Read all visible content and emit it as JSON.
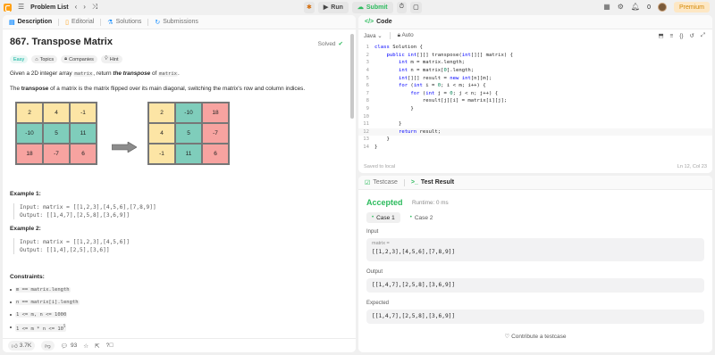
{
  "topnav": {
    "problem_list": "Problem List",
    "run": "Run",
    "submit": "Submit",
    "notifications": "0",
    "premium": "Premium"
  },
  "left": {
    "tabs": [
      "Description",
      "Editorial",
      "Solutions",
      "Submissions"
    ],
    "title": "867. Transpose Matrix",
    "solved": "Solved",
    "chips": [
      "Easy",
      "Topics",
      "Companies",
      "Hint"
    ],
    "p1_a": "Given a 2D integer array ",
    "p1_code1": "matrix",
    "p1_b": ", return ",
    "p1_em": "the transpose",
    "p1_c": " of ",
    "p1_code2": "matrix",
    "p1_d": ".",
    "p2_a": "The ",
    "p2_b": "transpose",
    "p2_c": " of a matrix is the matrix flipped over its main diagonal, switching the matrix's row and column indices.",
    "matrix_a": [
      [
        "2",
        "4",
        "-1"
      ],
      [
        "-10",
        "5",
        "11"
      ],
      [
        "18",
        "-7",
        "6"
      ]
    ],
    "matrix_b": [
      [
        "2",
        "-10",
        "18"
      ],
      [
        "4",
        "5",
        "-7"
      ],
      [
        "-1",
        "11",
        "6"
      ]
    ],
    "colors": {
      "yellow": "#fce5a5",
      "teal": "#7fcdbb",
      "red": "#f7a3a0"
    },
    "example1_title": "Example 1:",
    "example1_body": "Input: matrix = [[1,2,3],[4,5,6],[7,8,9]]\nOutput: [[1,4,7],[2,5,8],[3,6,9]]",
    "example2_title": "Example 2:",
    "example2_body": "Input: matrix = [[1,2,3],[4,5,6]]\nOutput: [[1,4],[2,5],[3,6]]",
    "constraints_title": "Constraints:",
    "constraints": [
      "m == matrix.length",
      "n == matrix[i].length",
      "1 <= m, n <= 1000",
      "1 <= m * n <= 10"
    ],
    "constraint_sup": "5",
    "likes": "3.7K",
    "comments": "93"
  },
  "code": {
    "tab": "Code",
    "language": "Java",
    "auto": "Auto",
    "lines": [
      "class Solution {",
      "    public int[][] transpose(int[][] matrix) {",
      "        int m = matrix.length;",
      "        int n = matrix[0].length;",
      "        int[][] result = new int[n][m];",
      "        for (int i = 0; i < m; i++) {",
      "            for (int j = 0; j < n; j++) {",
      "                result[j][i] = matrix[i][j];",
      "            }",
      "",
      "        }",
      "        return result;",
      "    }",
      "}"
    ],
    "saved": "Saved to local",
    "cursor": "Ln 12, Col 23"
  },
  "result": {
    "tabs": [
      "Testcase",
      "Test Result"
    ],
    "status": "Accepted",
    "runtime": "Runtime: 0 ms",
    "cases": [
      "Case 1",
      "Case 2"
    ],
    "input_label": "Input",
    "input_sub": "matrix =",
    "input_value": "[[1,2,3],[4,5,6],[7,8,9]]",
    "output_label": "Output",
    "output_value": "[[1,4,7],[2,5,8],[3,6,9]]",
    "expected_label": "Expected",
    "expected_value": "[[1,4,7],[2,5,8],[3,6,9]]",
    "contribute": "Contribute a testcase"
  }
}
